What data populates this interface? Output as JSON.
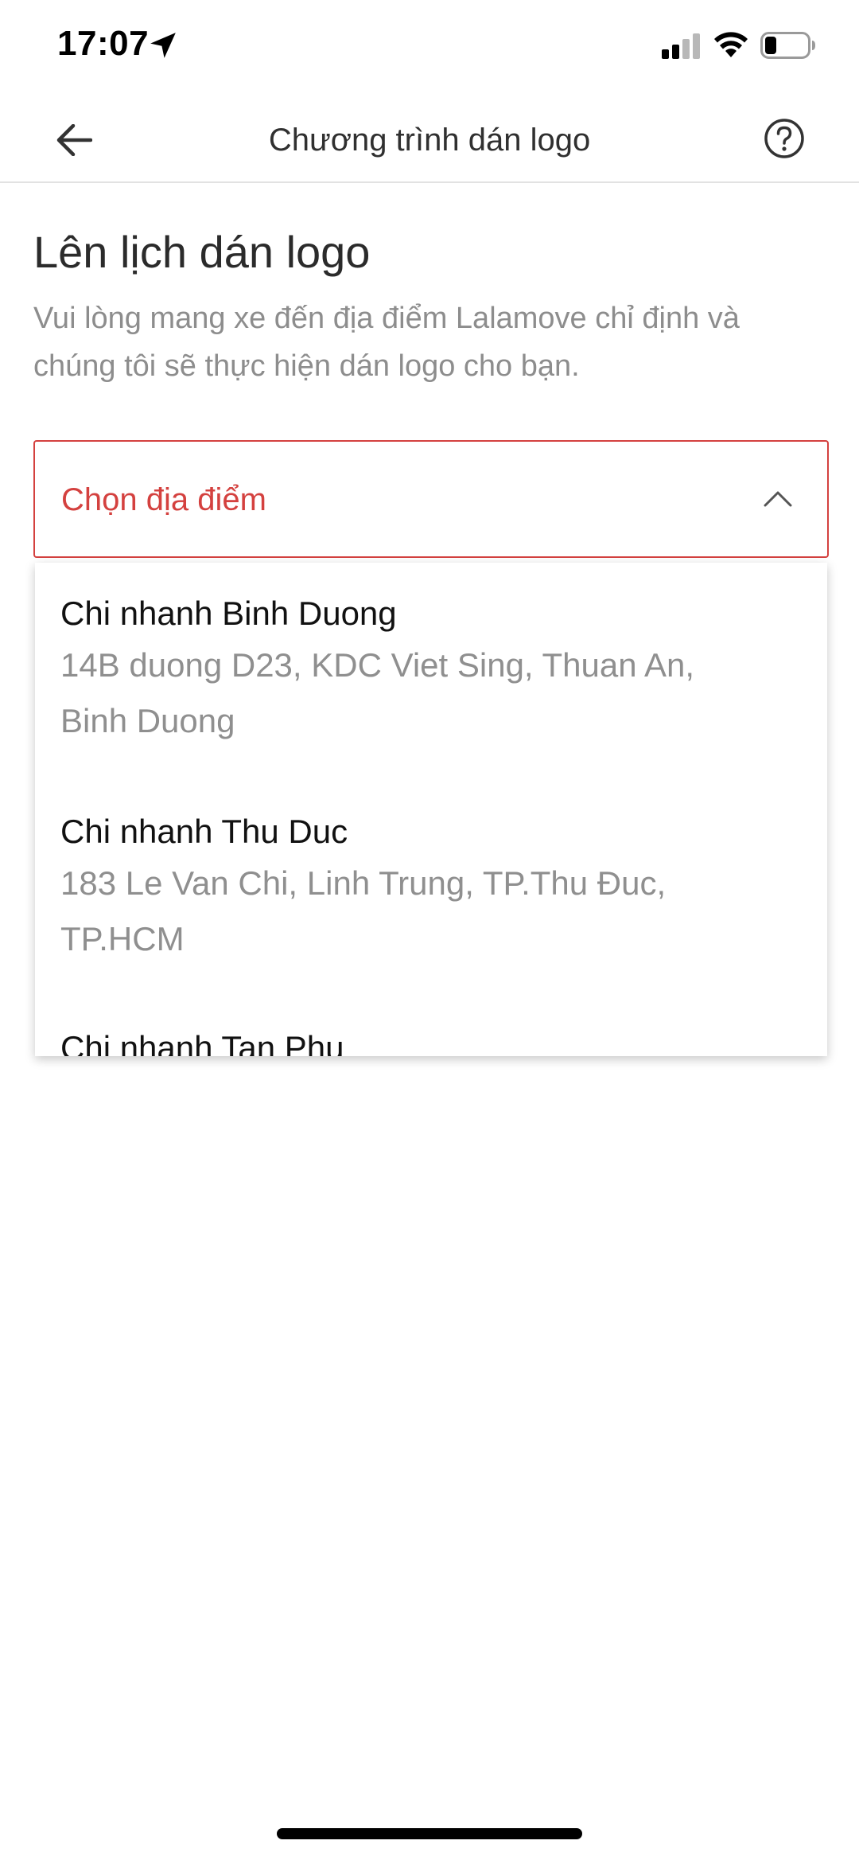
{
  "status_bar": {
    "time": "17:07",
    "icons": [
      "location-arrow-icon",
      "signal-icon",
      "wifi-icon",
      "battery-icon"
    ]
  },
  "header": {
    "title": "Chương trình dán logo",
    "back_icon": "arrow-left-icon",
    "help_icon": "question-circle-icon"
  },
  "main": {
    "title": "Lên lịch dán logo",
    "description": "Vui lòng mang xe đến địa điểm Lalamove chỉ định và chúng tôi sẽ thực hiện dán logo cho bạn."
  },
  "location_select": {
    "placeholder": "Chọn địa điểm",
    "expanded": true,
    "accent_color": "#d4413f",
    "options": [
      {
        "name": "Chi nhanh Binh Duong",
        "address_line1": "14B duong D23, KDC Viet Sing, Thuan An,",
        "address_line2": "Binh Duong"
      },
      {
        "name": "Chi nhanh Thu Duc",
        "address_line1": "183 Le Van Chi, Linh Trung, TP.Thu Đuc,",
        "address_line2": "TP.HCM"
      },
      {
        "name": "Chi nhanh Tan Phu"
      }
    ]
  }
}
